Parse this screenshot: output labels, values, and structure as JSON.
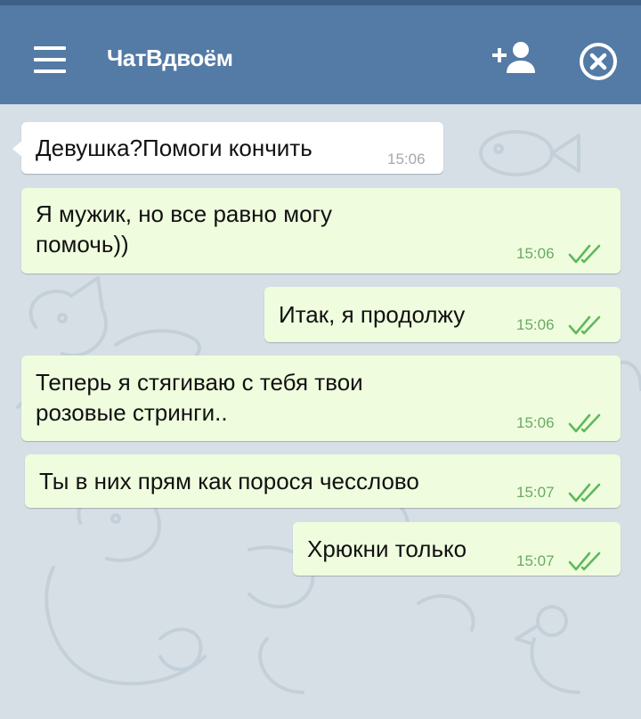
{
  "header": {
    "title": "ЧатВдвоём",
    "menu_icon": "hamburger-menu-icon",
    "add_user_icon": "add-user-icon",
    "close_icon": "close-circle-icon",
    "background_color": "#547aa6"
  },
  "messages": [
    {
      "text_lines": [
        "Девушка?Помоги кончить"
      ],
      "time": "15:06",
      "direction": "incoming"
    },
    {
      "text_lines": [
        "Я мужик, но все равно могу",
        "помочь))"
      ],
      "time": "15:06",
      "direction": "outgoing",
      "status": "read"
    },
    {
      "text_lines": [
        "Итак, я продолжу"
      ],
      "time": "15:06",
      "direction": "outgoing",
      "status": "read"
    },
    {
      "text_lines": [
        "Теперь я стягиваю с тебя твои",
        "розовые стринги.."
      ],
      "time": "15:06",
      "direction": "outgoing",
      "status": "read"
    },
    {
      "text_lines": [
        "Ты в них прям как порося чесслово"
      ],
      "time": "15:07",
      "direction": "outgoing",
      "status": "read"
    },
    {
      "text_lines": [
        "Хрюкни только"
      ],
      "time": "15:07",
      "direction": "outgoing",
      "status": "read"
    }
  ],
  "colors": {
    "incoming_bubble": "#ffffff",
    "outgoing_bubble": "#effdde",
    "read_check": "#5fb95a",
    "chat_background": "#d6dfe6"
  }
}
